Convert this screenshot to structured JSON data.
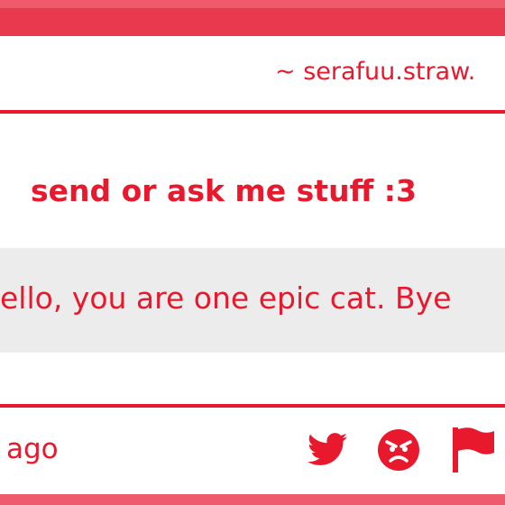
{
  "header": {
    "handle": "~ serafuu.straw."
  },
  "prompt": {
    "title": "send or ask me stuff :3"
  },
  "message": {
    "text": "ello, you are one epic cat. Bye"
  },
  "footer": {
    "time_label": "ago",
    "icons": [
      "twitter-icon",
      "angry-face-icon",
      "flag-icon"
    ]
  },
  "colors": {
    "accent": "#e8192c",
    "band": "#e9394e",
    "message_bg": "#ececec"
  }
}
